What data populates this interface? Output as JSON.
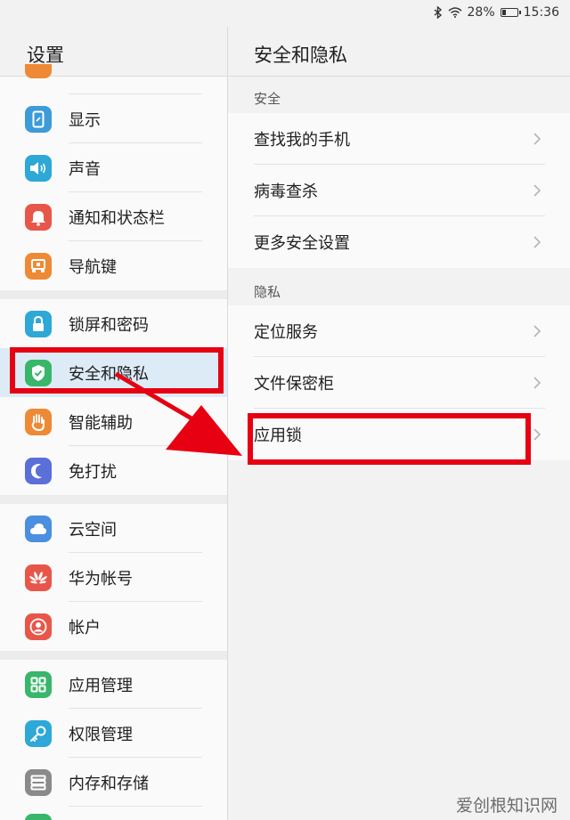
{
  "status_bar": {
    "battery": "28%",
    "battery_level": 0.28,
    "time": "15:36"
  },
  "left": {
    "title": "设置",
    "groups": [
      {
        "items": [
          {
            "label": "显示",
            "icon": "display-icon",
            "color": "#3d9bd8"
          },
          {
            "label": "声音",
            "icon": "speaker-icon",
            "color": "#2ea8d6"
          },
          {
            "label": "通知和状态栏",
            "icon": "bell-icon",
            "color": "#e8564a"
          },
          {
            "label": "导航键",
            "icon": "navigation-key-icon",
            "color": "#ee8a35"
          }
        ]
      },
      {
        "items": [
          {
            "label": "锁屏和密码",
            "icon": "lock-icon",
            "color": "#2ea8d6"
          },
          {
            "label": "安全和隐私",
            "icon": "shield-icon",
            "color": "#38b66a"
          },
          {
            "label": "智能辅助",
            "icon": "hand-icon",
            "color": "#ee8a35"
          },
          {
            "label": "免打扰",
            "icon": "moon-icon",
            "color": "#5b6fd8"
          }
        ]
      },
      {
        "items": [
          {
            "label": "云空间",
            "icon": "cloud-icon",
            "color": "#4a8fe0"
          },
          {
            "label": "华为帐号",
            "icon": "huawei-icon",
            "color": "#e8564a"
          },
          {
            "label": "帐户",
            "icon": "account-icon",
            "color": "#e8564a"
          }
        ]
      },
      {
        "items": [
          {
            "label": "应用管理",
            "icon": "apps-icon",
            "color": "#38b66a"
          },
          {
            "label": "权限管理",
            "icon": "key-icon",
            "color": "#2ea8d6"
          },
          {
            "label": "内存和存储",
            "icon": "storage-icon",
            "color": "#8a8a8a"
          }
        ]
      }
    ]
  },
  "right": {
    "title": "安全和隐私",
    "sections": [
      {
        "header": "安全",
        "items": [
          "查找我的手机",
          "病毒查杀",
          "更多安全设置"
        ]
      },
      {
        "header": "隐私",
        "items": [
          "定位服务",
          "文件保密柜",
          "应用锁"
        ]
      }
    ]
  },
  "watermark": "爱创根知识网",
  "colors": {
    "highlight": "#e60012",
    "selected_bg": "#ddebf7"
  }
}
